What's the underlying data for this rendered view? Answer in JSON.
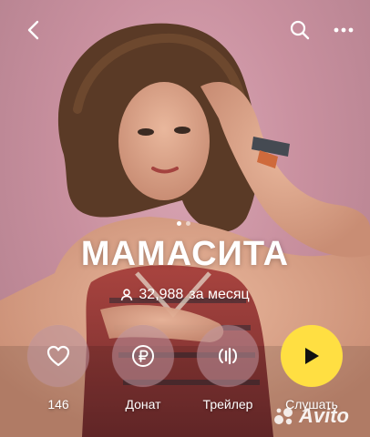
{
  "artist": {
    "name": "МАМАСИТА"
  },
  "listeners": {
    "count": "32,988",
    "period": "за месяц",
    "icon": "person-icon"
  },
  "pager": {
    "total": 2,
    "active": 0
  },
  "actions": {
    "like": {
      "label": "146",
      "icon": "heart-icon"
    },
    "donate": {
      "label": "Донат",
      "icon": "ruble-icon"
    },
    "trailer": {
      "label": "Трейлер",
      "icon": "waveform-icon"
    },
    "listen": {
      "label": "Слушать",
      "icon": "play-icon"
    }
  },
  "watermark": {
    "text": "Avito"
  },
  "colors": {
    "accent": "#ffdf42",
    "text": "#ffffff"
  }
}
